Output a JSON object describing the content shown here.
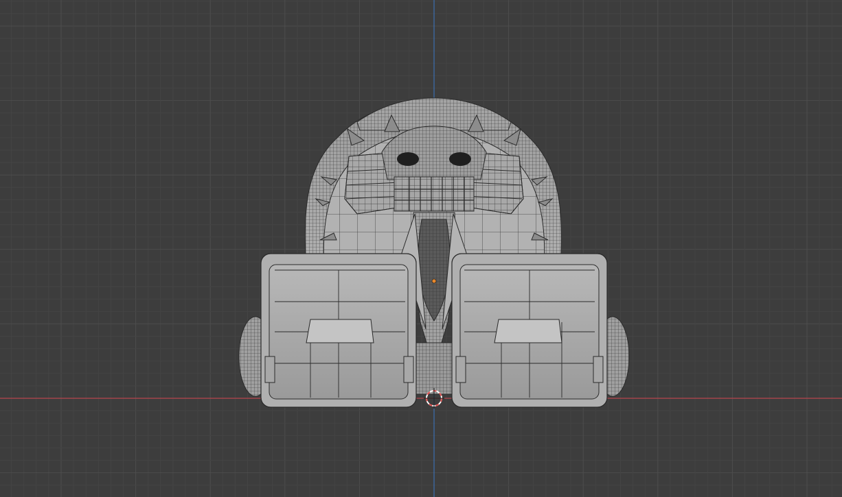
{
  "app": "3D viewport",
  "view": {
    "background_color": "#3d3d3d",
    "grid_minor_color": "#444444",
    "grid_major_color": "#4d4d4d",
    "x_axis_color": "#b8464e",
    "y_axis_color": "#3d6fb0",
    "mesh_fill_color": "#a8a8a8",
    "wire_color": "#2a2a2a",
    "origin_color": "#e8882c",
    "cursor_colors": [
      "#e05050",
      "#ffffff"
    ]
  },
  "scene": {
    "object": "mech-head-mesh",
    "display_mode": "solid-with-wireframe",
    "has_3d_cursor": true,
    "has_object_origin": true
  }
}
